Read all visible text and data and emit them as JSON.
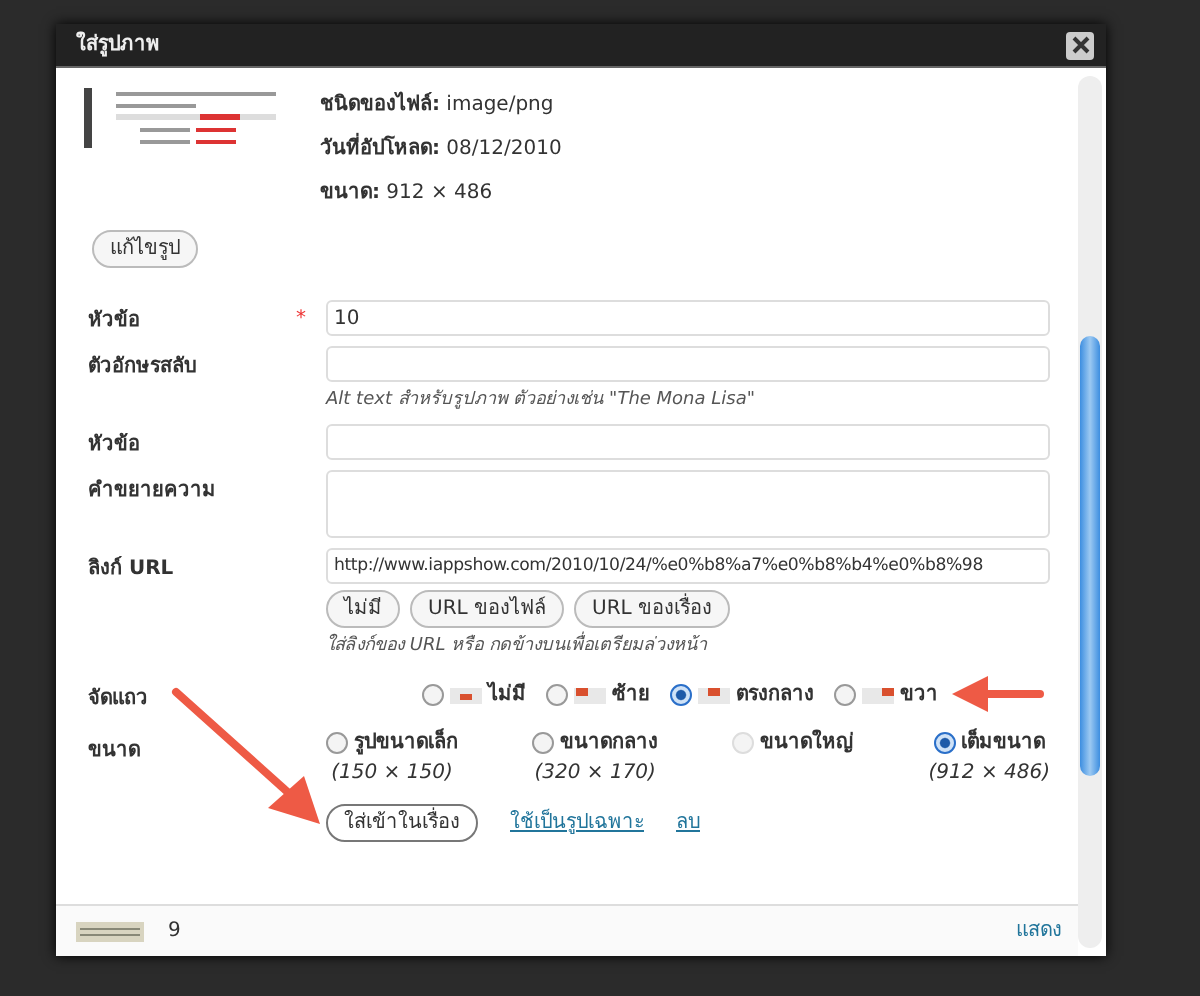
{
  "dialog": {
    "title": "ใส่รูปภาพ",
    "file_info": [
      {
        "label": "ชนิดของไฟล์:",
        "value": "image/png"
      },
      {
        "label": "วันที่อัปโหลด:",
        "value": "08/12/2010"
      },
      {
        "label": "ขนาด:",
        "value": "912 × 486"
      }
    ],
    "edit_button": "แก้ไขรูป",
    "fields": [
      {
        "label": "หัวข้อ",
        "required_mark": "*",
        "kind": "input",
        "value": "10"
      },
      {
        "label": "ตัวอักษรสลับ",
        "kind": "input",
        "hint": "Alt text สำหรับรูปภาพ ตัวอย่างเช่น \"The Mona Lisa\""
      },
      {
        "label": "หัวข้อ",
        "kind": "input"
      },
      {
        "label": "คำขยายความ",
        "kind": "textarea"
      }
    ],
    "link": {
      "label": "ลิงก์ URL",
      "value": "http://www.iappshow.com/2010/10/24/%e0%b8%a7%e0%b8%b4%e0%b8%98",
      "buttons": [
        "ไม่มี",
        "URL ของไฟล์",
        "URL ของเรื่อง"
      ],
      "hint": "ใส่ลิงก์ของ URL หรือ กดข้างบนเพื่อเตรียมล่วงหน้า"
    },
    "alignment": {
      "label": "จัดแถว",
      "options": [
        {
          "label": "ไม่มี",
          "kind": "none",
          "selected": false
        },
        {
          "label": "ซ้าย",
          "kind": "left",
          "selected": false
        },
        {
          "label": "ตรงกลาง",
          "kind": "center",
          "selected": true
        },
        {
          "label": "ขวา",
          "kind": "right",
          "selected": false
        }
      ]
    },
    "size": {
      "label": "ขนาด",
      "options": [
        {
          "label": "รูปขนาดเล็ก",
          "dims": "(150 × 150)",
          "selected": false,
          "disabled": false
        },
        {
          "label": "ขนาดกลาง",
          "dims": "(320 × 170)",
          "selected": false,
          "disabled": false
        },
        {
          "label": "ขนาดใหญ่",
          "selected": false,
          "disabled": true
        },
        {
          "label": "เต็มขนาด",
          "dims": "(912 × 486)",
          "selected": true,
          "disabled": false
        }
      ]
    },
    "actions": {
      "insert": "ใส่เข้าในเรื่อง",
      "featured": "ใช้เป็นรูปเฉพาะ",
      "delete": "ลบ"
    },
    "next_item": {
      "number": "9",
      "link": "แสดง"
    }
  }
}
